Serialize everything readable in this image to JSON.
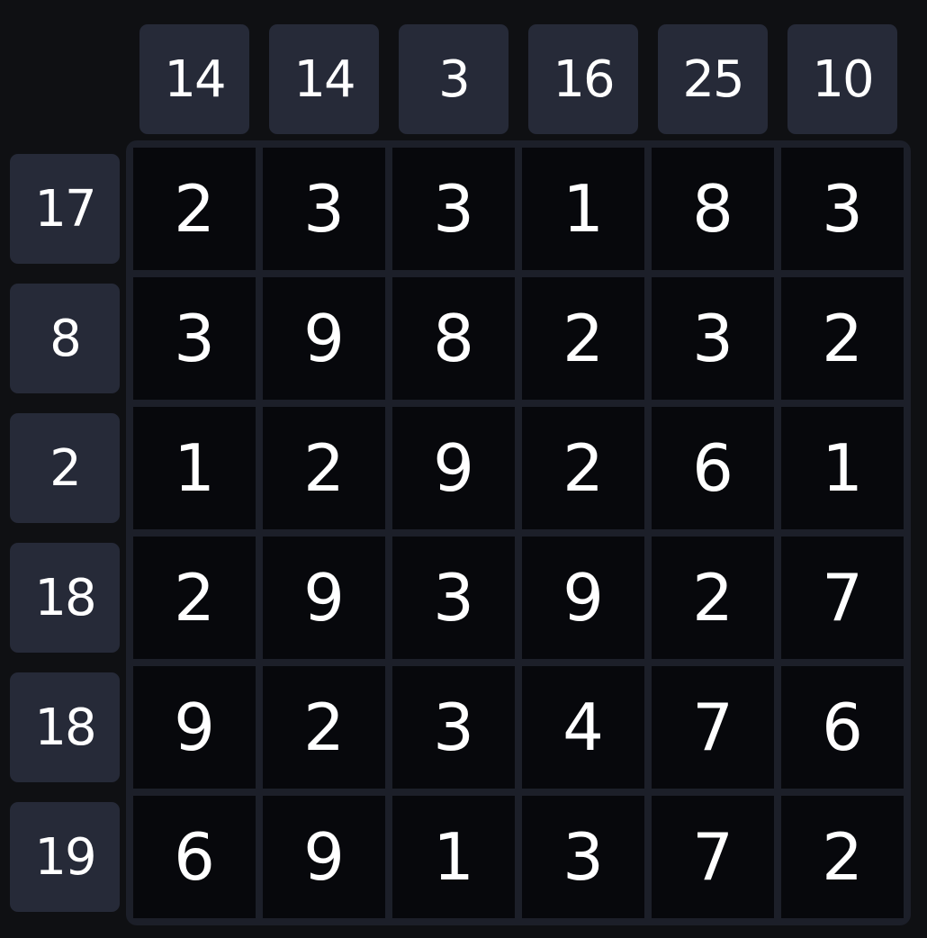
{
  "column_clues": [
    "14",
    "14",
    "3",
    "16",
    "25",
    "10"
  ],
  "row_clues": [
    "17",
    "8",
    "2",
    "18",
    "18",
    "19"
  ],
  "grid": [
    [
      "2",
      "3",
      "3",
      "1",
      "8",
      "3"
    ],
    [
      "3",
      "9",
      "8",
      "2",
      "3",
      "2"
    ],
    [
      "1",
      "2",
      "9",
      "2",
      "6",
      "1"
    ],
    [
      "2",
      "9",
      "3",
      "9",
      "2",
      "7"
    ],
    [
      "9",
      "2",
      "3",
      "4",
      "7",
      "6"
    ],
    [
      "6",
      "9",
      "1",
      "3",
      "7",
      "2"
    ]
  ]
}
